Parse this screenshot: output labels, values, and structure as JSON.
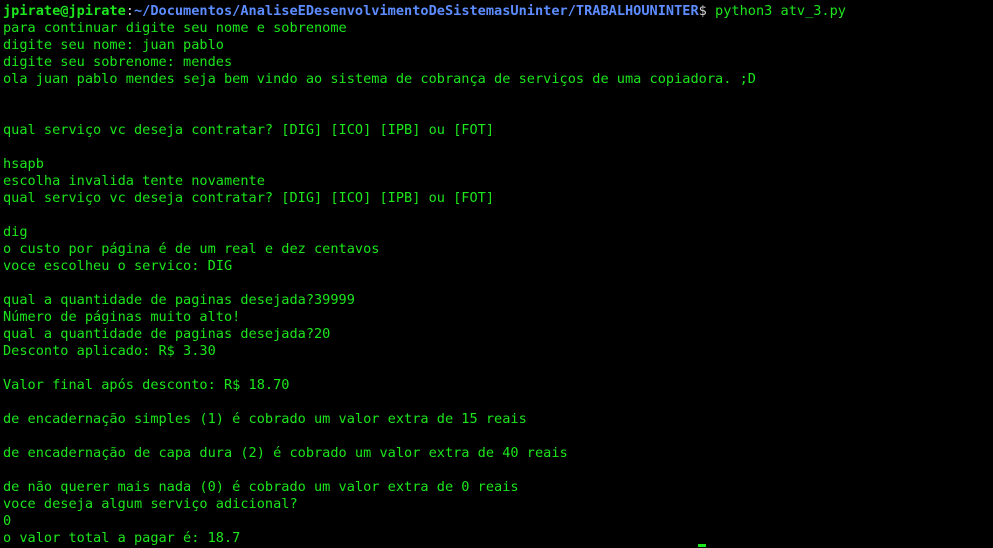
{
  "prompt": {
    "user_host": "jpirate@jpirate",
    "separator": ":",
    "path": "~/Documentos/AnaliseEDesenvolvimentoDeSistemasUninter/TRABALHOUNINTER",
    "dollar": "$",
    "command": " python3 atv_3.py"
  },
  "lines": [
    "para continuar digite seu nome e sobrenome",
    "digite seu nome: juan pablo",
    "digite seu sobrenome: mendes",
    "ola juan pablo mendes seja bem vindo ao sistema de cobrança de serviços de uma copiadora. ;D",
    "",
    "",
    "qual serviço vc deseja contratar? [DIG] [ICO] [IPB] ou [FOT]",
    "",
    "hsapb",
    "escolha invalida tente novamente",
    "qual serviço vc deseja contratar? [DIG] [ICO] [IPB] ou [FOT]",
    "",
    "dig",
    "o custo por página é de um real e dez centavos",
    "voce escolheu o servico: DIG",
    "",
    "qual a quantidade de paginas desejada?39999",
    "Número de páginas muito alto!",
    "qual a quantidade de paginas desejada?20",
    "Desconto aplicado: R$ 3.30",
    "",
    "Valor final após desconto: R$ 18.70",
    "",
    "de encadernação simples (1) é cobrado um valor extra de 15 reais",
    "",
    "de encadernação de capa dura (2) é cobrado um valor extra de 40 reais",
    "",
    "de não querer mais nada (0) é cobrado um valor extra de 0 reais",
    "voce deseja algum serviço adicional?",
    "0",
    "o valor total a pagar é: 18.7"
  ]
}
